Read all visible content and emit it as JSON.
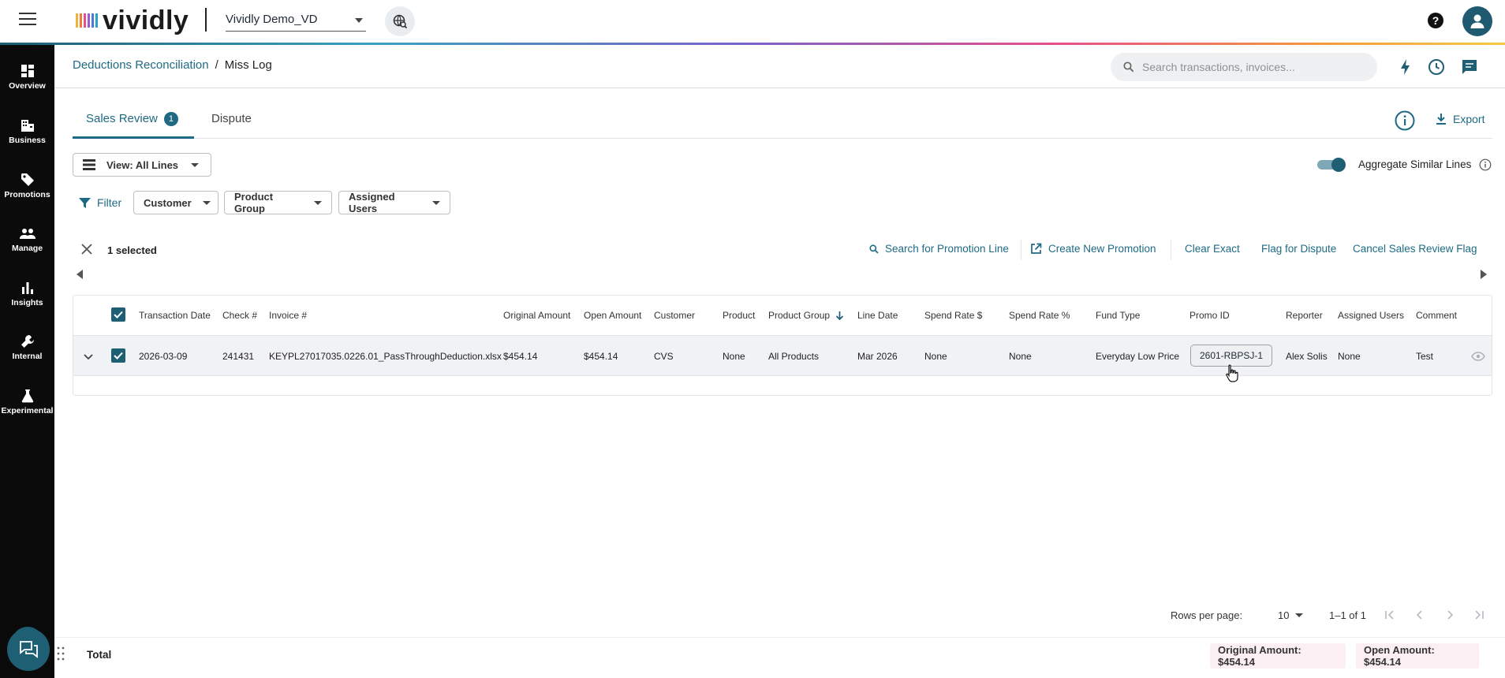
{
  "app": {
    "logo_text": "vividly",
    "org": "Vividly Demo_VD"
  },
  "icons": {
    "menu": "hamburger-icon",
    "search": "search-icon",
    "help": "help-icon",
    "user": "user-icon"
  },
  "colors": {
    "accent": "#1e6a84",
    "sidebar": "#0b0b0b",
    "row_highlight": "#f0f2f5"
  },
  "sidebar": {
    "items": [
      "Overview",
      "Business",
      "Promotions",
      "Manage",
      "Insights",
      "Internal",
      "Experimental"
    ]
  },
  "breadcrumb": {
    "parent": "Deductions Reconciliation",
    "separator": "/",
    "current": "Miss Log"
  },
  "search": {
    "placeholder": "Search transactions, invoices..."
  },
  "tabs": {
    "sales_review": "Sales Review",
    "badge": "1",
    "dispute": "Dispute",
    "export": "Export"
  },
  "view": {
    "label": "View: All Lines"
  },
  "aggregate": {
    "label": "Aggregate Similar Lines",
    "enabled": true
  },
  "filters": {
    "label": "Filter",
    "customer": "Customer",
    "product_group": "Product Group",
    "assigned_users": "Assigned Users"
  },
  "selection": {
    "count_label": "1 selected",
    "actions": {
      "search_promo": "Search for Promotion Line",
      "create_promo": "Create New Promotion",
      "clear_exact": "Clear Exact",
      "flag_dispute": "Flag for Dispute",
      "cancel_flag": "Cancel Sales Review Flag"
    }
  },
  "table": {
    "headers": {
      "transaction_date": "Transaction Date",
      "check": "Check #",
      "invoice": "Invoice #",
      "original_amount": "Original Amount",
      "open_amount": "Open Amount",
      "customer": "Customer",
      "product": "Product",
      "product_group": "Product Group",
      "line_date": "Line Date",
      "spend_rate_dollar": "Spend Rate $",
      "spend_rate_pct": "Spend Rate %",
      "fund_type": "Fund Type",
      "promo_id": "Promo ID",
      "reporter": "Reporter",
      "assigned_users": "Assigned Users",
      "comment": "Comment"
    },
    "rows": [
      {
        "transaction_date": "2026-03-09",
        "check": "241431",
        "invoice": "KEYPL27017035.0226.01_PassThroughDeduction.xlsx",
        "original_amount": "$454.14",
        "open_amount": "$454.14",
        "customer": "CVS",
        "product": "None",
        "product_group": "All Products",
        "line_date": "Mar 2026",
        "spend_rate_dollar": "None",
        "spend_rate_pct": "None",
        "fund_type": "Everyday Low Price",
        "promo_id": "2601-RBPSJ-1",
        "reporter": "Alex Solis",
        "assigned_users": "None",
        "comment": "Test"
      }
    ]
  },
  "pagination": {
    "rows_per_page_label": "Rows per page:",
    "rows_per_page": "10",
    "range": "1–1 of 1"
  },
  "footer": {
    "total_label": "Total",
    "original_amount": "Original Amount: $454.14",
    "open_amount": "Open Amount: $454.14"
  }
}
